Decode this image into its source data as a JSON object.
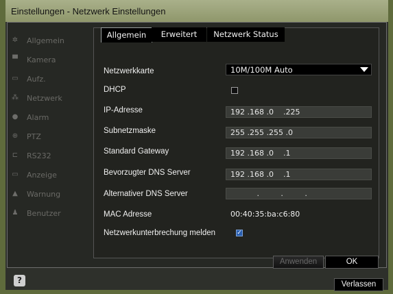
{
  "window": {
    "title": "Einstellungen - Netzwerk Einstellungen"
  },
  "sidebar": {
    "items": [
      {
        "label": "Allgemein",
        "icon": "gear-icon"
      },
      {
        "label": "Kamera",
        "icon": "camera-icon"
      },
      {
        "label": "Aufz.",
        "icon": "record-icon"
      },
      {
        "label": "Netzwerk",
        "icon": "network-icon"
      },
      {
        "label": "Alarm",
        "icon": "alarm-icon"
      },
      {
        "label": "PTZ",
        "icon": "ptz-icon"
      },
      {
        "label": "RS232",
        "icon": "rs232-icon"
      },
      {
        "label": "Anzeige",
        "icon": "display-icon"
      },
      {
        "label": "Warnung",
        "icon": "warning-icon"
      },
      {
        "label": "Benutzer",
        "icon": "user-icon"
      }
    ]
  },
  "tabs": [
    {
      "label": "Allgemein",
      "active": true
    },
    {
      "label": "Erweitert",
      "active": false
    },
    {
      "label": "Netzwerk Status",
      "active": false
    }
  ],
  "form": {
    "network_card": {
      "label": "Netzwerkkarte",
      "value": "10M/100M Auto"
    },
    "dhcp": {
      "label": "DHCP",
      "checked": false
    },
    "ip": {
      "label": "IP-Adresse",
      "value": "192 .168 .0    .225"
    },
    "subnet": {
      "label": "Subnetzmaske",
      "value": "255 .255 .255 .0"
    },
    "gateway": {
      "label": "Standard Gateway",
      "value": "192 .168 .0    .1"
    },
    "dns_preferred": {
      "label": "Bevorzugter DNS Server",
      "value": "192 .168 .0    .1"
    },
    "dns_alternate": {
      "label": "Alternativer DNS Server",
      "value": "           .         .         ."
    },
    "mac": {
      "label": "MAC Adresse",
      "value": "00:40:35:ba:c6:80"
    },
    "network_interrupt": {
      "label": "Netzwerkunterbrechung melden",
      "checked": true
    }
  },
  "buttons": {
    "apply": "Anwenden",
    "ok": "OK",
    "exit": "Verlassen",
    "help": "?"
  }
}
